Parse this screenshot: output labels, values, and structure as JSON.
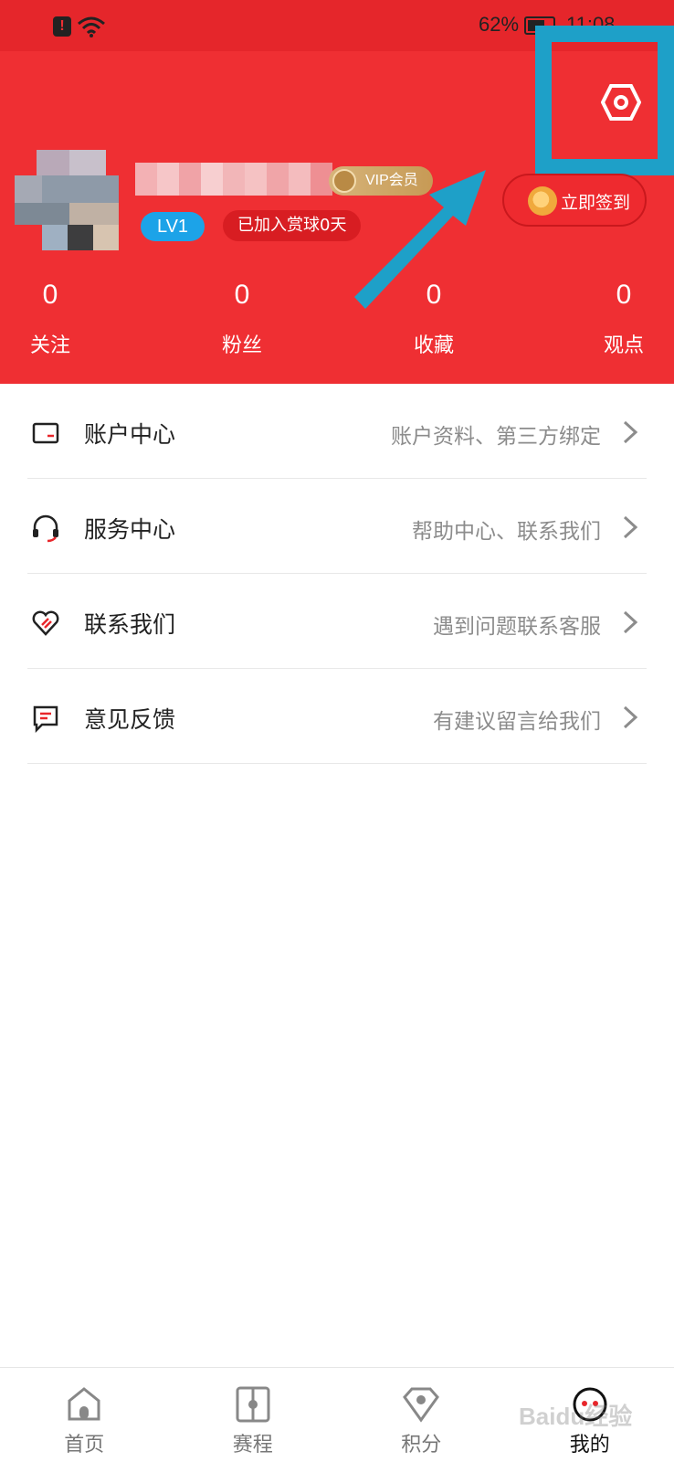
{
  "status_bar": {
    "battery": "62%",
    "time": "11:08",
    "alert": "!"
  },
  "profile": {
    "vip_label": "VIP会员",
    "level": "LV1",
    "joined": "已加入赏球0天",
    "sign_in_label": "立即签到"
  },
  "stats": [
    {
      "value": "0",
      "label": "关注"
    },
    {
      "value": "0",
      "label": "粉丝"
    },
    {
      "value": "0",
      "label": "收藏"
    },
    {
      "value": "0",
      "label": "观点"
    }
  ],
  "menu": [
    {
      "title": "账户中心",
      "desc": "账户资料、第三方绑定",
      "icon": "card-icon"
    },
    {
      "title": "服务中心",
      "desc": "帮助中心、联系我们",
      "icon": "headset-icon"
    },
    {
      "title": "联系我们",
      "desc": "遇到问题联系客服",
      "icon": "heart-icon"
    },
    {
      "title": "意见反馈",
      "desc": "有建议留言给我们",
      "icon": "chat-icon"
    }
  ],
  "tabs": [
    {
      "label": "首页",
      "icon": "home-icon"
    },
    {
      "label": "赛程",
      "icon": "schedule-icon"
    },
    {
      "label": "积分",
      "icon": "points-icon"
    },
    {
      "label": "我的",
      "icon": "profile-icon",
      "active": true
    }
  ],
  "watermark": "Baidu经验",
  "colors": {
    "header": "#ef2f33",
    "highlight": "#1ea0c8",
    "level_badge": "#1ca3e8",
    "vip": "#c79a55"
  }
}
